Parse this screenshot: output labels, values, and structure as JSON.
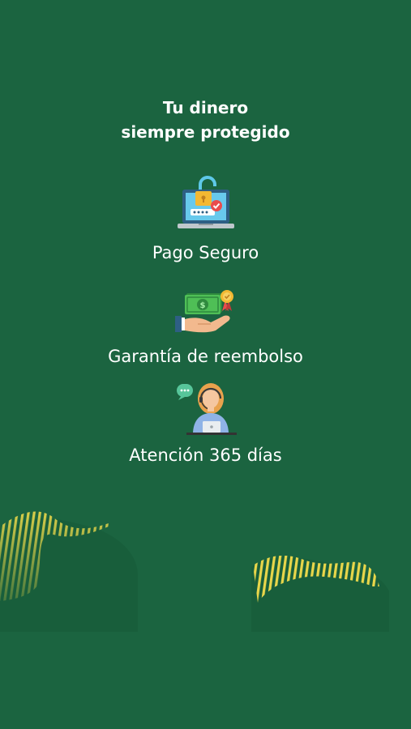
{
  "header": {
    "line1": "Tu dinero",
    "line2": "siempre protegido"
  },
  "features": [
    {
      "label": "Pago Seguro",
      "icon": "secure-laptop-lock-icon"
    },
    {
      "label": "Garantía de reembolso",
      "icon": "money-hand-refund-icon"
    },
    {
      "label": "Atención 365 días",
      "icon": "support-agent-icon"
    }
  ],
  "colors": {
    "background": "#1b6440",
    "accent_yellow": "#e8d64a",
    "text": "#ffffff"
  }
}
